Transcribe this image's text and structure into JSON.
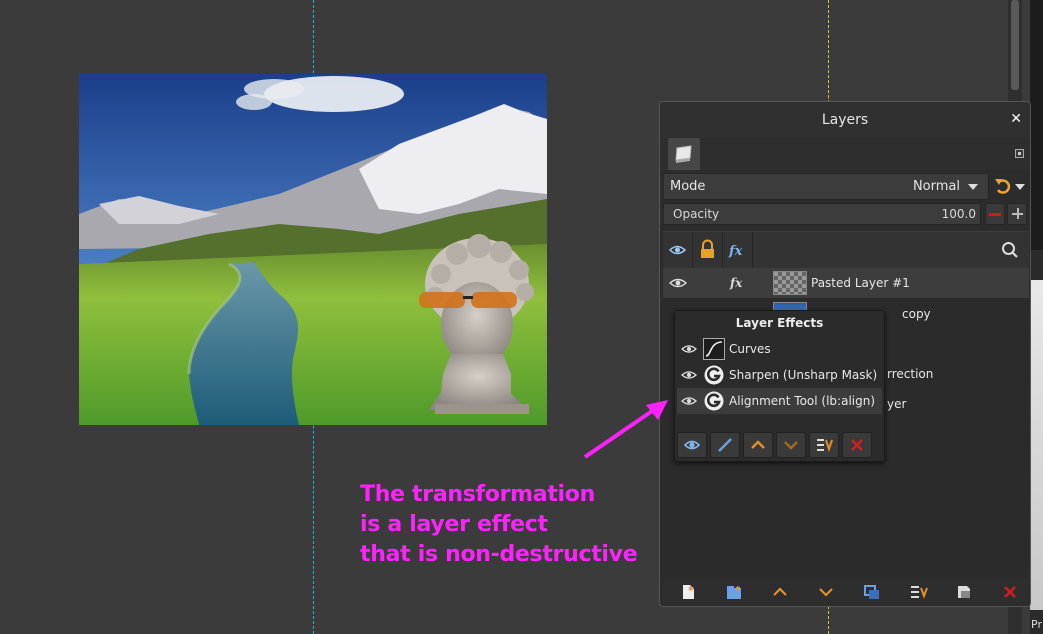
{
  "canvas": {
    "guide_color_cyan": "#18b9d6",
    "guide_color_yellow": "#d8c24a"
  },
  "layers_dock": {
    "title": "Layers",
    "close_icon": "close-icon",
    "mode_label": "Mode",
    "mode_value": "Normal",
    "opacity_label": "Opacity",
    "opacity_value": "100.0",
    "header_icons": [
      "eye-icon",
      "lock-icon",
      "fx-icon",
      "search-icon"
    ],
    "layers": [
      {
        "name": "Pasted Layer #1",
        "visible": true,
        "has_fx": true,
        "selected": true
      },
      {
        "name": "copy",
        "visible": true,
        "has_fx": false,
        "selected": false
      },
      {
        "name": "rrection",
        "visible": true,
        "has_fx": false,
        "selected": false
      },
      {
        "name": "yer",
        "visible": true,
        "has_fx": false,
        "selected": false
      }
    ],
    "bottom_buttons": [
      "new-layer-icon",
      "new-group-icon",
      "raise-icon",
      "lower-icon",
      "anchor-icon",
      "merge-icon",
      "mask-icon",
      "delete-icon"
    ]
  },
  "layer_effects": {
    "title": "Layer Effects",
    "effects": [
      {
        "name": "Curves",
        "icon": "curves-icon",
        "visible": true
      },
      {
        "name": "Sharpen (Unsharp Mask)",
        "icon": "gegl-icon",
        "visible": true
      },
      {
        "name": "Alignment Tool (lb:align)",
        "icon": "gegl-icon",
        "visible": true
      }
    ],
    "tools": [
      "eye-toggle-icon",
      "edit-icon",
      "raise-icon",
      "lower-icon",
      "merge-down-icon",
      "delete-icon"
    ]
  },
  "annotation": {
    "lines": [
      "The transformation",
      "is a layer effect",
      "that is non-destructive"
    ],
    "color": "#ff22ff"
  },
  "right_edge_label": "Pr"
}
